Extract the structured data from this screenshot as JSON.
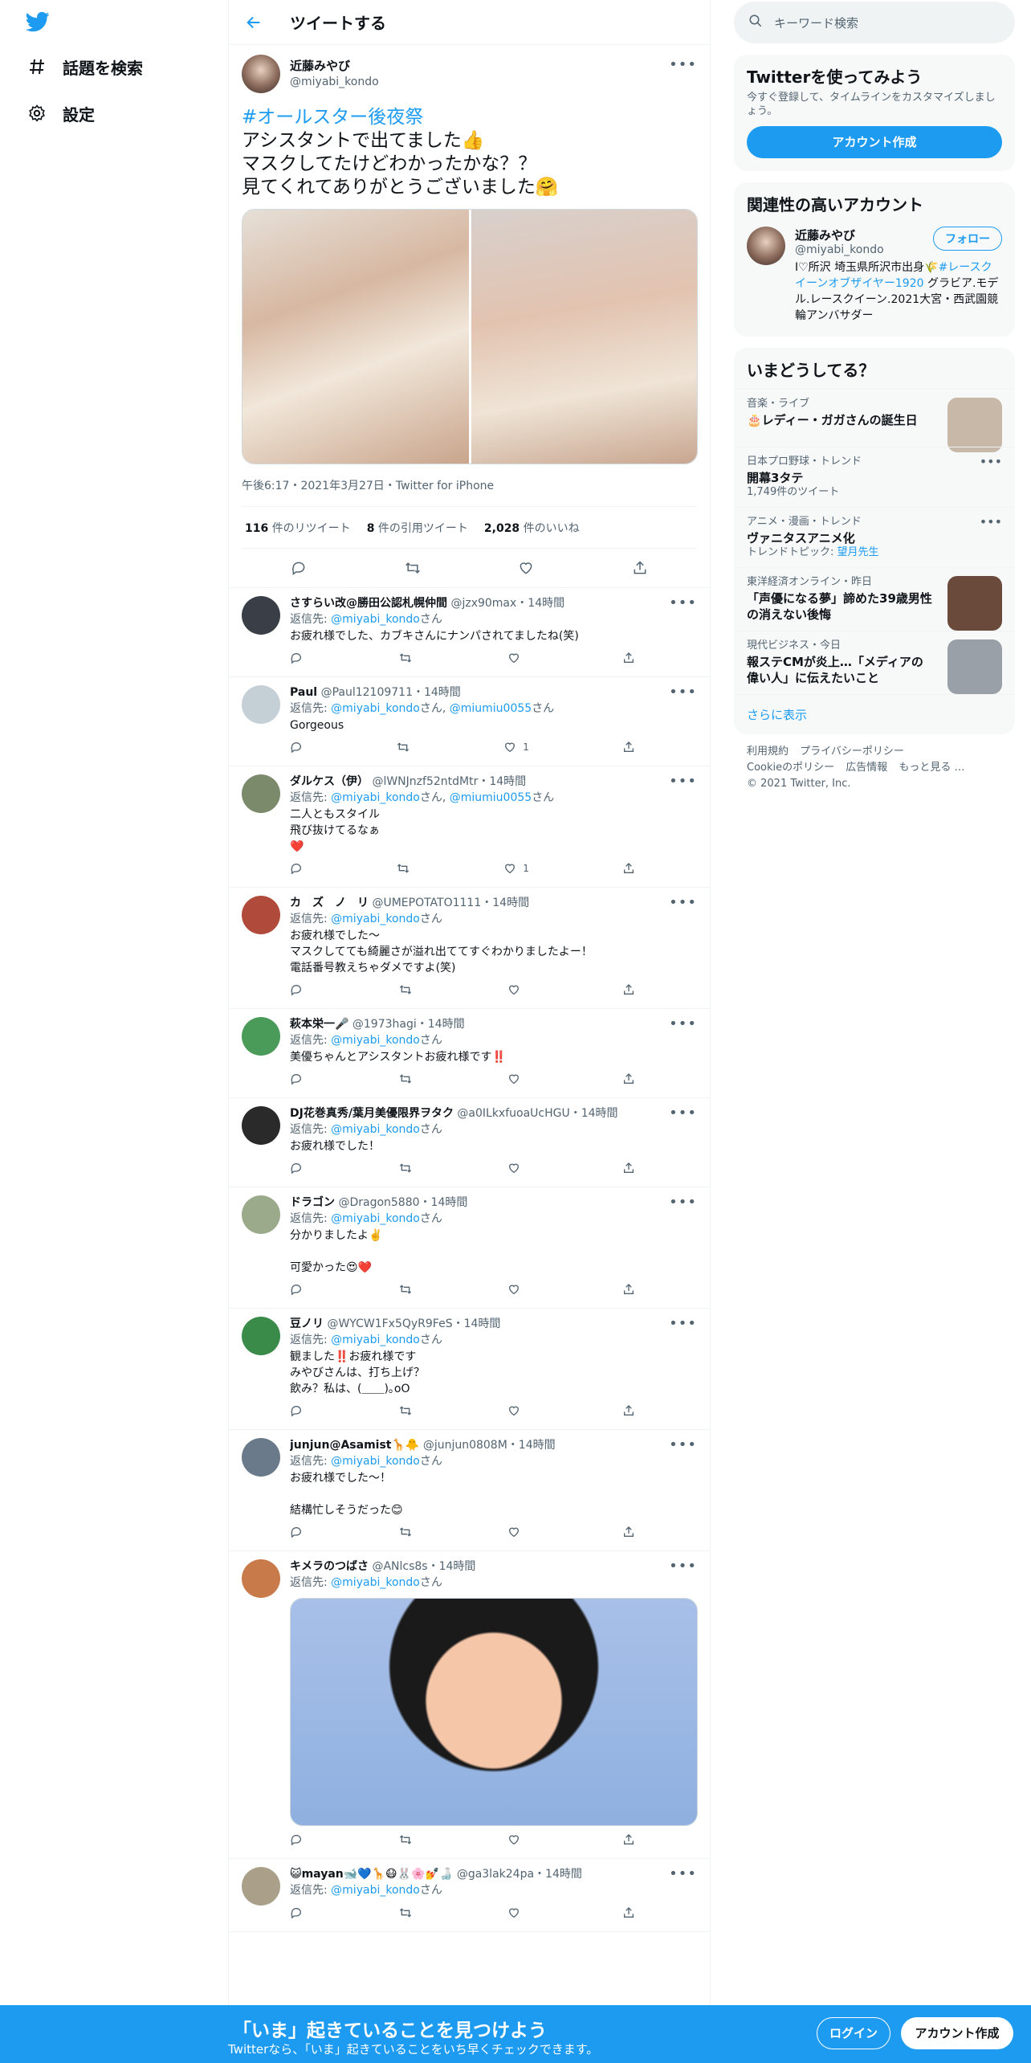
{
  "nav": {
    "explore": "話題を検索",
    "settings": "設定"
  },
  "header": {
    "title": "ツイートする"
  },
  "main_tweet": {
    "name": "近藤みやび",
    "handle": "@miyabi_kondo",
    "hashtag": "#オールスター後夜祭",
    "text": "アシスタントで出てました👍\nマスクしてたけどわかったかな？？\n見てくれてありがとうございました🤗",
    "meta": "午後6:17・2021年3月27日・Twitter for iPhone",
    "retweets": "116",
    "retweets_label": "件のリツイート",
    "quotes": "8",
    "quotes_label": "件の引用ツイート",
    "likes": "2,028",
    "likes_label": "件のいいね"
  },
  "replies": [
    {
      "name": "さすらい改@勝田公認札幌仲間",
      "handle": "@jzx90max",
      "time": "・14時間",
      "to_prefix": "返信先: ",
      "to": "@miyabi_kondo",
      "to2": "",
      "to_suffix": "さん",
      "text": "お疲れ様でした、カブキさんにナンパされてましたね(笑)",
      "likes": "",
      "color": "#3a3f47"
    },
    {
      "name": "Paul",
      "handle": "@Paul12109711",
      "time": "・14時間",
      "to_prefix": "返信先: ",
      "to": "@miyabi_kondo",
      "to2": "@miumiu0055",
      "to_suffix": "さん",
      "text": "Gorgeous",
      "likes": "1",
      "color": "#c4cfd6"
    },
    {
      "name": "ダルケス（伊）",
      "handle": "@lWNJnzf52ntdMtr",
      "time": "・14時間",
      "to_prefix": "返信先: ",
      "to": "@miyabi_kondo",
      "to2": "@miumiu0055",
      "to_suffix": "さん",
      "text": "二人ともスタイル\n飛び抜けてるなぁ\n❤️",
      "likes": "1",
      "color": "#7a8a6a"
    },
    {
      "name": "カ　ズ　ノ　リ",
      "handle": "@UMEPOTATO1111",
      "time": "・14時間",
      "to_prefix": "返信先: ",
      "to": "@miyabi_kondo",
      "to2": "",
      "to_suffix": "さん",
      "text": "お疲れ様でした～\nマスクしてても綺麗さが溢れ出ててすぐわかりましたよー！\n電話番号教えちゃダメですよ(笑)",
      "likes": "",
      "color": "#b04a3a"
    },
    {
      "name": "萩本栄一🎤",
      "handle": "@1973hagi",
      "time": "・14時間",
      "to_prefix": "返信先: ",
      "to": "@miyabi_kondo",
      "to2": "",
      "to_suffix": "さん",
      "text": "美優ちゃんとアシスタントお疲れ様です‼️",
      "likes": "",
      "color": "#4a9a5a"
    },
    {
      "name": "DJ花巻真秀/葉月美優限界ヲタク",
      "handle": "@a0ILkxfuoaUcHGU",
      "time": "・14時間",
      "to_prefix": "返信先: ",
      "to": "@miyabi_kondo",
      "to2": "",
      "to_suffix": "さん",
      "text": "お疲れ様でした！",
      "likes": "",
      "color": "#2a2a2a"
    },
    {
      "name": "ドラゴン",
      "handle": "@Dragon5880",
      "time": "・14時間",
      "to_prefix": "返信先: ",
      "to": "@miyabi_kondo",
      "to2": "",
      "to_suffix": "さん",
      "text": "分かりましたよ✌️\n\n可愛かった😍❤️",
      "likes": "",
      "color": "#9aaa8a"
    },
    {
      "name": "豆ノリ",
      "handle": "@WYCW1Fx5QyR9FeS",
      "time": "・14時間",
      "to_prefix": "返信先: ",
      "to": "@miyabi_kondo",
      "to2": "",
      "to_suffix": "さん",
      "text": "観ました‼️お疲れ様です\nみやびさんは、打ち上げ？\n飲み？私は、(＿＿)｡oO",
      "likes": "",
      "color": "#3a8a4a"
    },
    {
      "name": "junjun@Asamist🦒🐥",
      "handle": "@junjun0808M",
      "time": "・14時間",
      "to_prefix": "返信先: ",
      "to": "@miyabi_kondo",
      "to2": "",
      "to_suffix": "さん",
      "text": "お疲れ様でした～！\n\n結構忙しそうだった😊",
      "likes": "",
      "color": "#6a7a8a"
    },
    {
      "name": "キメラのつばさ",
      "handle": "@ANlcs8s",
      "time": "・14時間",
      "to_prefix": "返信先: ",
      "to": "@miyabi_kondo",
      "to2": "",
      "to_suffix": "さん",
      "text": "",
      "likes": "",
      "color": "#c87a4a"
    },
    {
      "name": "😺mayan🐋💙🦒😷🐰🌸💅🍶",
      "handle": "@ga3lak24pa",
      "time": "・14時間",
      "to_prefix": "返信先: ",
      "to": "@miyabi_kondo",
      "to2": "",
      "to_suffix": "さん",
      "text": "",
      "likes": "",
      "color": "#aaa08a"
    }
  ],
  "right": {
    "search_placeholder": "キーワード検索",
    "try_title": "Twitterを使ってみよう",
    "try_text": "今すぐ登録して、タイムラインをカスタマイズしましょう。",
    "create_btn": "アカウント作成",
    "related_title": "関連性の高いアカウント",
    "related_name": "近藤みやび",
    "related_handle": "@miyabi_kondo",
    "follow_btn": "フォロー",
    "related_bio_1": "I♡所沢 埼玉県所沢市出身🌾",
    "related_bio_tag": "#レースクイーンオブザイヤー1920",
    "related_bio_2": " グラビア.モデル.レースクイーン.2021大宮・西武園競輪アンバサダー",
    "trends_title": "いまどうしてる？",
    "trends": [
      {
        "cat": "音楽・ライブ",
        "name": "🎂レディー・ガガさんの誕生日",
        "count": "",
        "thumb": true
      },
      {
        "cat": "日本プロ野球・トレンド",
        "name": "開幕3タテ",
        "count": "1,749件のツイート",
        "thumb": false
      },
      {
        "cat": "アニメ・漫画・トレンド",
        "name": "ヴァニタスアニメ化",
        "count": "トレンドトピック: ",
        "count_link": "望月先生",
        "thumb": false
      },
      {
        "cat": "東洋経済オンライン・昨日",
        "name": "「声優になる夢」諦めた39歳男性の消えない後悔",
        "count": "",
        "thumb": true
      },
      {
        "cat": "現代ビジネス・今日",
        "name": "報ステCMが炎上…「メディアの偉い人」に伝えたいこと",
        "count": "",
        "thumb": true
      }
    ],
    "show_more": "さらに表示",
    "footer": [
      "利用規約",
      "プライバシーポリシー",
      "Cookieのポリシー",
      "広告情報",
      "もっと見る …",
      "© 2021 Twitter, Inc."
    ]
  },
  "bottom": {
    "title": "「いま」起きていることを見つけよう",
    "subtitle": "Twitterなら、「いま」起きていることをいち早くチェックできます。",
    "login": "ログイン",
    "signup": "アカウント作成"
  },
  "colors": {
    "accent": "#1d9bf0",
    "text": "#0f1419",
    "muted": "#536471"
  }
}
